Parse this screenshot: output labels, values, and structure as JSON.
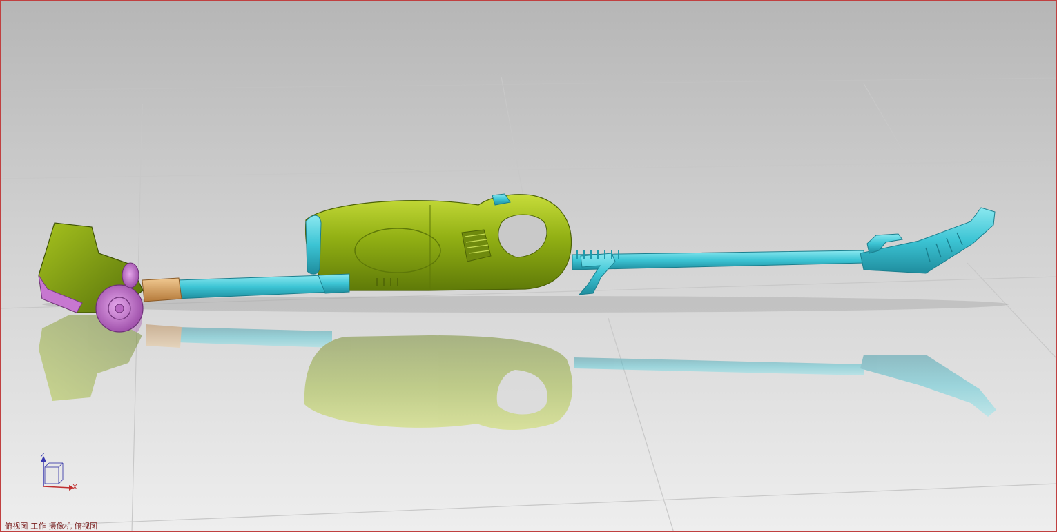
{
  "viewport": {
    "status_text": "俯视图 工作 摄像机 俯视图",
    "border_color": "#c04040"
  },
  "axis_triad": {
    "z_label": "Z",
    "x_label": "X",
    "z_color": "#3a3ab0",
    "x_color": "#c03030"
  },
  "model": {
    "body_color": "#8cab12",
    "tube_color": "#3fc6d6",
    "head_color": "#6f8a10",
    "wheel_color": "#c777d0",
    "collar_color": "#d9a66a",
    "icon": "vacuum-cleaner-model-icon"
  }
}
